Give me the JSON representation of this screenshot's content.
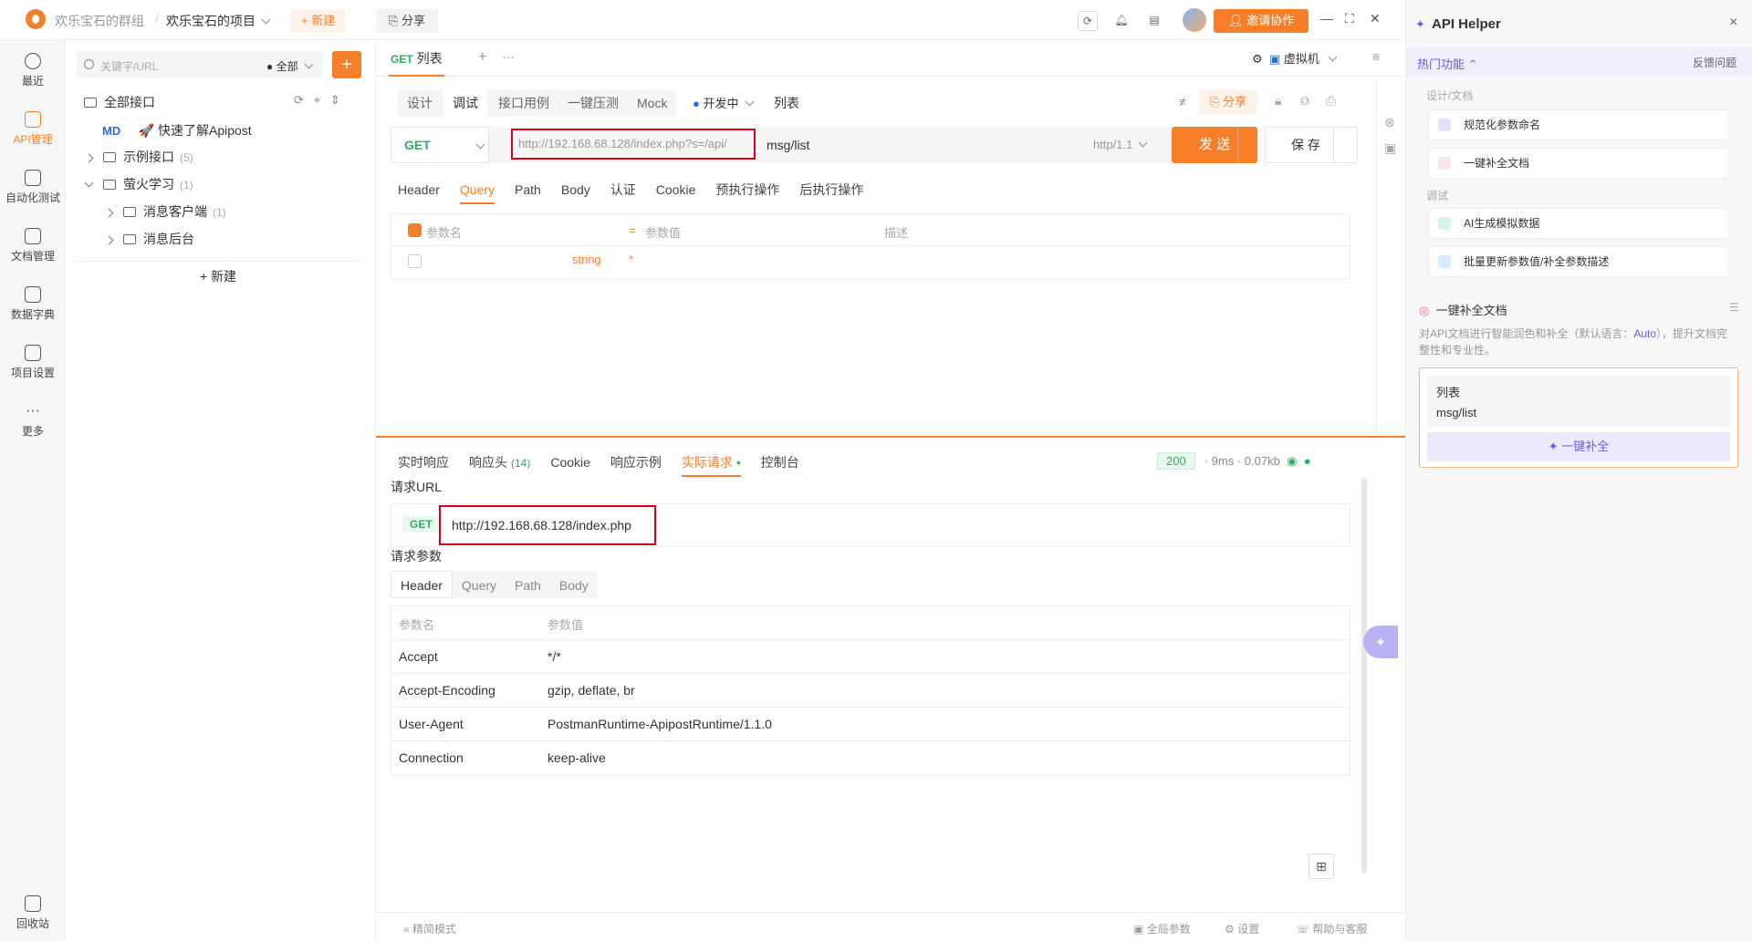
{
  "topbar": {
    "team": "欢乐宝石的群组",
    "separator": "/",
    "project": "欢乐宝石的项目",
    "new_label": "+ 新建",
    "share_label": "分享",
    "invite_label": "邀请协作"
  },
  "leftnav": [
    {
      "label": "最近",
      "icon": "clock-icon"
    },
    {
      "label": "API管理",
      "icon": "api-icon",
      "active": true
    },
    {
      "label": "自动化测试",
      "icon": "automation-icon"
    },
    {
      "label": "文档管理",
      "icon": "doc-icon"
    },
    {
      "label": "数据字典",
      "icon": "dict-icon"
    },
    {
      "label": "项目设置",
      "icon": "settings-icon"
    },
    {
      "label": "更多",
      "icon": "more-icon"
    },
    {
      "label": "回收站",
      "icon": "trash-icon"
    }
  ],
  "tree": {
    "search_placeholder": "关键字/URL",
    "scope": "全部",
    "all_label": "全部接口",
    "md": "MD",
    "quick": "🚀 快速了解Apipost",
    "items": [
      {
        "label": "示例接口",
        "count": "(5)"
      },
      {
        "label": "萤火学习",
        "count": "(1)"
      },
      {
        "label": "消息客户端",
        "count": "(1)"
      },
      {
        "label": "消息后台",
        "count": ""
      }
    ],
    "new_label": "+ 新建"
  },
  "main": {
    "tab": {
      "method": "GET",
      "title": "列表"
    },
    "subtabs": [
      "设计",
      "调试",
      "接口用例",
      "一键压测",
      "Mock"
    ],
    "status": "开发中",
    "name": "列表",
    "share": "分享",
    "method": "GET",
    "url_prefix": "http://192.168.68.128/index.php?s=/api/",
    "url_path": "msg/list",
    "protocol": "http/1.1",
    "send": "发 送",
    "save": "保 存",
    "req_tabs": [
      "Header",
      "Query",
      "Path",
      "Body",
      "认证",
      "Cookie",
      "预执行操作",
      "后执行操作"
    ],
    "param_head": {
      "name": "参数名",
      "value": "参数值",
      "desc": "描述"
    },
    "param_type": "string",
    "param_required": "*",
    "resp_tabs": [
      "实时响应",
      "响应头",
      "Cookie",
      "响应示例",
      "实际请求",
      "控制台"
    ],
    "resp_header_count": "(14)",
    "status_code": "200",
    "time": "9ms",
    "size": "0.07kb",
    "req_url_label": "请求URL",
    "req_method": "GET",
    "req_url": "http://192.168.68.128/index.php",
    "req_params_label": "请求参数",
    "seg_tabs": [
      "Header",
      "Query",
      "Path",
      "Body"
    ],
    "headers": [
      {
        "k": "参数名",
        "v": "参数值"
      },
      {
        "k": "Accept",
        "v": "*/*"
      },
      {
        "k": "Accept-Encoding",
        "v": "gzip, deflate, br"
      },
      {
        "k": "User-Agent",
        "v": "PostmanRuntime-ApipostRuntime/1.1.0"
      },
      {
        "k": "Connection",
        "v": "keep-alive"
      }
    ],
    "footer": {
      "mode": "精简模式",
      "global": "全局参数",
      "settings": "设置",
      "help": "帮助与客服"
    }
  },
  "helper": {
    "title": "API Helper",
    "hot": "热门功能",
    "feedback": "反馈问题",
    "group1": "设计/文档",
    "f1": "规范化参数命名",
    "f2": "一键补全文档",
    "group2": "调试",
    "f3": "AI生成模拟数据",
    "f4": "批量更新参数值/补全参数描述",
    "sec_title": "一键补全文档",
    "desc_a": "对API文档进行智能润色和补全（默认语言：",
    "desc_lang": "Auto",
    "desc_b": "），提升文档完整性和专业性。",
    "card_name": "列表",
    "card_path": "msg/list",
    "card_btn": "✦ 一键补全"
  }
}
